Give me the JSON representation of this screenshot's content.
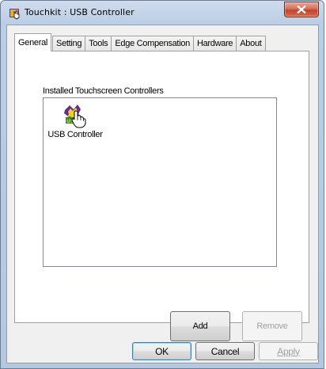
{
  "window": {
    "title": "Touchkit : USB Controller",
    "icon": "touchkit-app-icon",
    "close_icon": "close-x-icon"
  },
  "tabs": [
    {
      "label": "General",
      "active": true
    },
    {
      "label": "Setting",
      "active": false
    },
    {
      "label": "Tools",
      "active": false
    },
    {
      "label": "Edge Compensation",
      "active": false
    },
    {
      "label": "Hardware",
      "active": false
    },
    {
      "label": "About",
      "active": false
    }
  ],
  "general": {
    "list_label": "Installed Touchscreen Controllers",
    "controllers": [
      {
        "label": "USB Controller",
        "icon": "usb-controller-hand-icon"
      }
    ],
    "add_label": "Add",
    "remove_label": "Remove"
  },
  "footer": {
    "ok_label": "OK",
    "cancel_label": "Cancel",
    "apply_label": "Apply"
  },
  "colors": {
    "close_button": "#c7472d",
    "frame": "#b9cde4",
    "client_bg": "#f0f0f0"
  }
}
